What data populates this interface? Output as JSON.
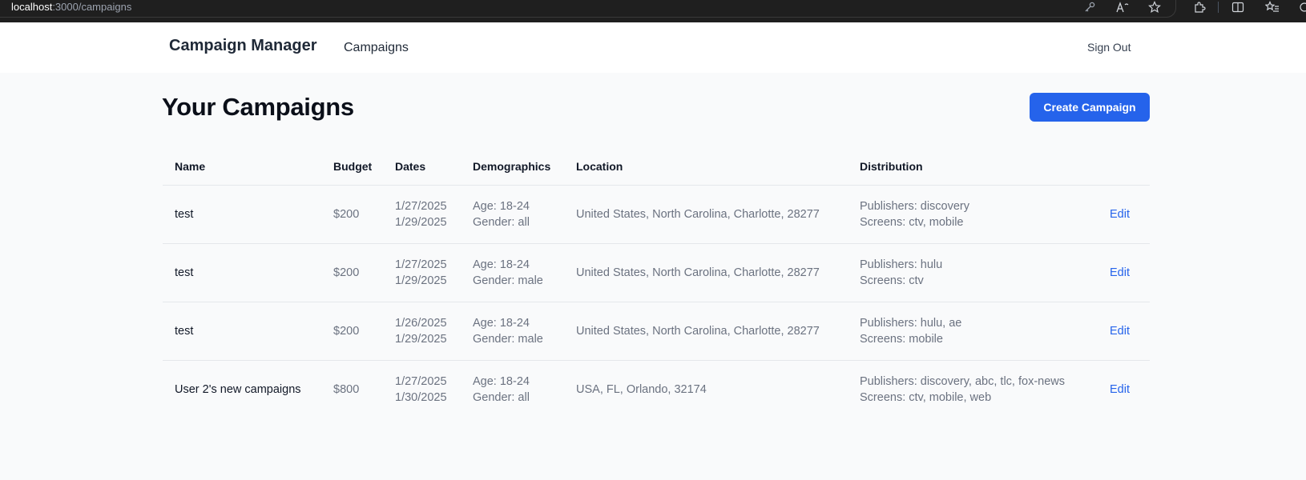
{
  "browser": {
    "url_host": "localhost",
    "url_path": ":3000/campaigns",
    "icons": [
      "key-icon",
      "read-aloud-icon",
      "favorite-star-icon",
      "extensions-icon",
      "split-screen-icon",
      "favorites-icon"
    ]
  },
  "nav": {
    "brand": "Campaign Manager",
    "campaigns_link": "Campaigns",
    "sign_out": "Sign Out"
  },
  "main": {
    "title": "Your Campaigns",
    "create_button": "Create Campaign"
  },
  "table": {
    "headers": [
      "Name",
      "Budget",
      "Dates",
      "Demographics",
      "Location",
      "Distribution"
    ],
    "rows": [
      {
        "name": "test",
        "budget": "$200",
        "start_date": "1/27/2025",
        "end_date": "1/29/2025",
        "age": "Age: 18-24",
        "gender": "Gender: all",
        "location": "United States, North Carolina, Charlotte, 28277",
        "publishers": "Publishers: discovery",
        "screens": "Screens: ctv, mobile",
        "edit": "Edit"
      },
      {
        "name": "test",
        "budget": "$200",
        "start_date": "1/27/2025",
        "end_date": "1/29/2025",
        "age": "Age: 18-24",
        "gender": "Gender: male",
        "location": "United States, North Carolina, Charlotte, 28277",
        "publishers": "Publishers: hulu",
        "screens": "Screens: ctv",
        "edit": "Edit"
      },
      {
        "name": "test",
        "budget": "$200",
        "start_date": "1/26/2025",
        "end_date": "1/29/2025",
        "age": "Age: 18-24",
        "gender": "Gender: male",
        "location": "United States, North Carolina, Charlotte, 28277",
        "publishers": "Publishers: hulu, ae",
        "screens": "Screens: mobile",
        "edit": "Edit"
      },
      {
        "name": "User 2's new campaigns",
        "budget": "$800",
        "start_date": "1/27/2025",
        "end_date": "1/30/2025",
        "age": "Age: 18-24",
        "gender": "Gender: all",
        "location": "USA, FL, Orlando, 32174",
        "publishers": "Publishers: discovery, abc, tlc, fox-news",
        "screens": "Screens: ctv, mobile, web",
        "edit": "Edit"
      }
    ]
  }
}
